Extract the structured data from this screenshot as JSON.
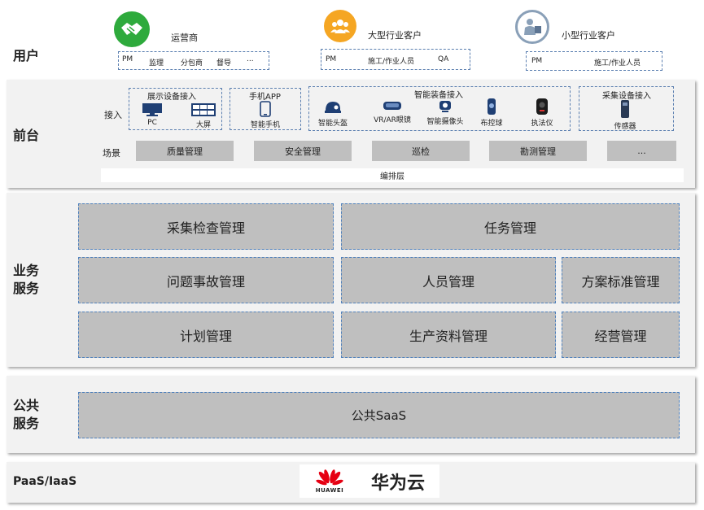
{
  "users": {
    "label": "用户",
    "groups": [
      {
        "title": "运营商",
        "icon": "handshake-icon",
        "color": "#2eaa3c",
        "items": [
          "PM",
          "监理",
          "分包商",
          "督导",
          "..."
        ]
      },
      {
        "title": "大型行业客户",
        "icon": "group-icon",
        "color": "#f5a623",
        "items": [
          "PM",
          "施工/作业人员",
          "QA"
        ]
      },
      {
        "title": "小型行业客户",
        "icon": "businessman-icon",
        "color": "#8aa0b8",
        "items": [
          "PM",
          "施工/作业人员"
        ]
      }
    ]
  },
  "frontend": {
    "label": "前台",
    "access_label": "接入",
    "scene_label": "场景",
    "access_groups": [
      {
        "title": "展示设备接入",
        "devices": [
          {
            "label": "PC",
            "icon": "monitor-icon"
          },
          {
            "label": "大屏",
            "icon": "video-wall-icon"
          }
        ]
      },
      {
        "title": "手机APP",
        "devices": [
          {
            "label": "智能手机",
            "icon": "smartphone-icon"
          }
        ]
      },
      {
        "title": "智能装备接入",
        "devices": [
          {
            "label": "智能头盔",
            "icon": "helmet-icon"
          },
          {
            "label": "VR/AR眼镜",
            "icon": "vr-glasses-icon"
          },
          {
            "label": "智能摄像头",
            "icon": "camera-icon"
          },
          {
            "label": "布控球",
            "icon": "dome-camera-icon"
          },
          {
            "label": "执法仪",
            "icon": "body-recorder-icon"
          }
        ]
      },
      {
        "title": "采集设备接入",
        "devices": [
          {
            "label": "传感器",
            "icon": "sensor-icon"
          }
        ]
      }
    ],
    "scenes": [
      "质量管理",
      "安全管理",
      "巡检",
      "勘测管理",
      "..."
    ],
    "orchestration": "编排层"
  },
  "business": {
    "label": "业务\n服务",
    "modules": [
      "采集检查管理",
      "任务管理",
      "问题事故管理",
      "人员管理",
      "方案标准管理",
      "计划管理",
      "生产资料管理",
      "经营管理"
    ]
  },
  "public": {
    "label": "公共\n服务",
    "saas": "公共SaaS"
  },
  "paas": {
    "label": "PaaS/IaaS",
    "logo_text": "HUAWEI",
    "cloud_name": "华为云",
    "logo_color": "#e60012"
  }
}
